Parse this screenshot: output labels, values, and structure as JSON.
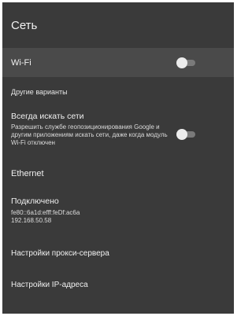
{
  "header": {
    "title": "Сеть"
  },
  "wifi": {
    "label": "Wi-Fi",
    "toggle_state": "off"
  },
  "other_options": {
    "label": "Другие варианты"
  },
  "always_scan": {
    "label": "Всегда искать сети",
    "description": "Разрешить службе геопозиционирования Google и другим приложениям искать сети, даже когда модуль Wi-Fi отключен",
    "toggle_state": "off"
  },
  "ethernet": {
    "label": "Ethernet"
  },
  "connection": {
    "label": "Подключено",
    "ipv6": "fe80::6a1d:efff:feDf:ac6a",
    "ipv4": "192.168.50.58"
  },
  "proxy": {
    "label": "Настройки прокси-сервера"
  },
  "ip_settings": {
    "label": "Настройки IP-адреса"
  },
  "colors": {
    "panel_bg": "#3a3a3a",
    "selected_row_bg": "#4a4a4a",
    "toggle_thumb": "#ececec",
    "toggle_track": "#7a7a7a"
  }
}
